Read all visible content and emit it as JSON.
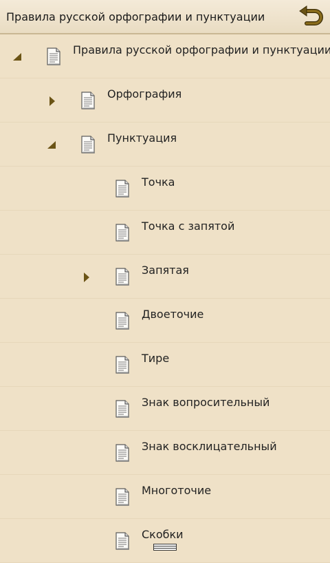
{
  "header": {
    "title": "Правила русской орфографии и пунктуации",
    "back_icon": "back-arrow-icon"
  },
  "tree": [
    {
      "label": "Правила русской орфографии и пунктуации",
      "level": 0,
      "toggle": "expanded"
    },
    {
      "label": "Орфография",
      "level": 1,
      "toggle": "collapsed"
    },
    {
      "label": "Пунктуация",
      "level": 1,
      "toggle": "expanded"
    },
    {
      "label": "Точка",
      "level": 2,
      "toggle": "none"
    },
    {
      "label": "Точка с запятой",
      "level": 2,
      "toggle": "none"
    },
    {
      "label": "Запятая",
      "level": 2,
      "toggle": "collapsed"
    },
    {
      "label": "Двоеточие",
      "level": 2,
      "toggle": "none"
    },
    {
      "label": "Тире",
      "level": 2,
      "toggle": "none"
    },
    {
      "label": "Знак вопросительный",
      "level": 2,
      "toggle": "none"
    },
    {
      "label": "Знак восклицательный",
      "level": 2,
      "toggle": "none"
    },
    {
      "label": "Многоточие",
      "level": 2,
      "toggle": "none"
    },
    {
      "label": "Скобки",
      "level": 2,
      "toggle": "none"
    }
  ],
  "colors": {
    "background": "#efe1c7",
    "accent": "#6b5416"
  }
}
